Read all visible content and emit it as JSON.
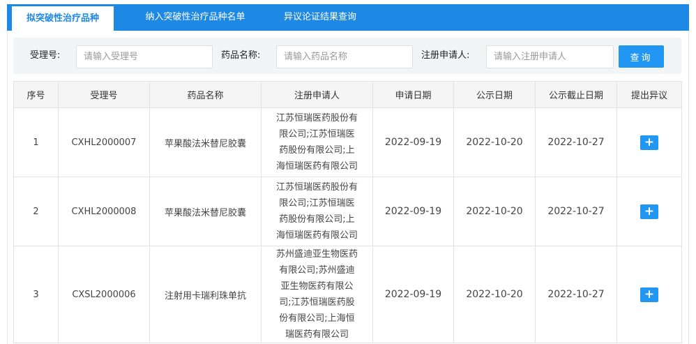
{
  "tabs": [
    {
      "label": "拟突破性治疗品种",
      "active": true
    },
    {
      "label": "纳入突破性治疗品种名单",
      "active": false
    },
    {
      "label": "异议论证结果查询",
      "active": false
    }
  ],
  "search": {
    "accept_label": "受理号:",
    "accept_placeholder": "请输入受理号",
    "drug_label": "药品名称:",
    "drug_placeholder": "请输入药品名称",
    "applicant_label": "注册申请人:",
    "applicant_placeholder": "请输入注册申请人",
    "query_label": "查询"
  },
  "table": {
    "headers": [
      "序号",
      "受理号",
      "药品名称",
      "注册申请人",
      "申请日期",
      "公示日期",
      "公示截止日期",
      "提出异议"
    ],
    "rows": [
      {
        "no": "1",
        "accept_no": "CXHL2000007",
        "drug": "苹果酸法米替尼胶囊",
        "applicant": [
          "江苏恒瑞医药股份有",
          "限公司;江苏恒瑞医",
          "药股份有限公司;上",
          "海恒瑞医药有限公司"
        ],
        "apply_date": "2022-09-19",
        "publish_date": "2022-10-20",
        "deadline": "2022-10-27",
        "action": "+"
      },
      {
        "no": "2",
        "accept_no": "CXHL2000008",
        "drug": "苹果酸法米替尼胶囊",
        "applicant": [
          "江苏恒瑞医药股份有",
          "限公司;江苏恒瑞医",
          "药股份有限公司;上",
          "海恒瑞医药有限公司"
        ],
        "apply_date": "2022-09-19",
        "publish_date": "2022-10-20",
        "deadline": "2022-10-27",
        "action": "+"
      },
      {
        "no": "3",
        "accept_no": "CXSL2000006",
        "drug": "注射用卡瑞利珠单抗",
        "applicant": [
          "苏州盛迪亚生物医药",
          "有限公司;苏州盛迪",
          "亚生物医药有限公",
          "司;江苏恒瑞医药股",
          "份有限公司;上海恒",
          "瑞医药有限公司"
        ],
        "apply_date": "2022-09-19",
        "publish_date": "2022-10-20",
        "deadline": "2022-10-27",
        "action": "+"
      }
    ]
  },
  "colors": {
    "accent": "#1e88e5",
    "button": "#2196f3"
  }
}
